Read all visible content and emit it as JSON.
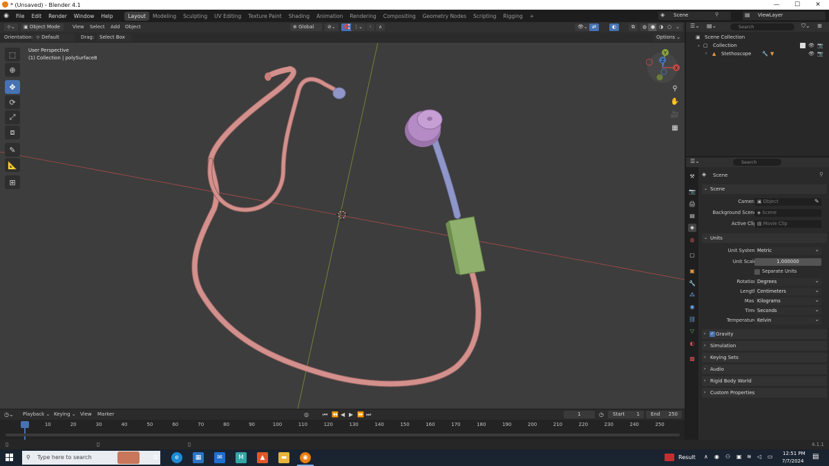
{
  "window": {
    "title": "* (Unsaved) - Blender 4.1"
  },
  "menu": [
    "File",
    "Edit",
    "Render",
    "Window",
    "Help"
  ],
  "workspaces": [
    "Layout",
    "Modeling",
    "Sculpting",
    "UV Editing",
    "Texture Paint",
    "Shading",
    "Animation",
    "Rendering",
    "Compositing",
    "Geometry Nodes",
    "Scripting",
    "Rigging"
  ],
  "scene_selector": "Scene",
  "view_layer": "ViewLayer",
  "viewport_header": {
    "mode": "Object Mode",
    "menus": [
      "View",
      "Select",
      "Add",
      "Object"
    ],
    "transform_orientation": "Global"
  },
  "tool_header": {
    "orientation_label": "Orientation:",
    "orientation_value": "Default",
    "drag_label": "Drag:",
    "drag_value": "Select Box",
    "options_label": "Options"
  },
  "viewport": {
    "perspective_label": "User Perspective",
    "collection_label": "(1) Collection | polySurface8",
    "gizmo": {
      "x": "X",
      "y": "Y",
      "z": "Z"
    }
  },
  "outliner": {
    "search_placeholder": "Search",
    "scene_collection": "Scene Collection",
    "collection": "Collection",
    "object": "Stethoscope"
  },
  "properties": {
    "search_placeholder": "Search",
    "context_title": "Scene",
    "scene_panel": {
      "title": "Scene",
      "camera_label": "Camera",
      "camera_placeholder": "Object",
      "background_scene_label": "Background Scene",
      "background_scene_placeholder": "Scene",
      "active_clip_label": "Active Clip",
      "active_clip_placeholder": "Movie Clip"
    },
    "units_panel": {
      "title": "Units",
      "unit_system_label": "Unit System",
      "unit_system_value": "Metric",
      "unit_scale_label": "Unit Scale",
      "unit_scale_value": "1.000000",
      "separate_units_label": "Separate Units",
      "rotation_label": "Rotation",
      "rotation_value": "Degrees",
      "length_label": "Length",
      "length_value": "Centimeters",
      "mass_label": "Mass",
      "mass_value": "Kilograms",
      "time_label": "Time",
      "time_value": "Seconds",
      "temperature_label": "Temperature",
      "temperature_value": "Kelvin"
    },
    "collapsed_panels": [
      "Gravity",
      "Simulation",
      "Keying Sets",
      "Audio",
      "Rigid Body World",
      "Custom Properties"
    ],
    "gravity_checked": true
  },
  "timeline": {
    "menus": [
      "Playback",
      "Keying",
      "View",
      "Marker"
    ],
    "current_frame": "1",
    "start_label": "Start",
    "start_value": "1",
    "end_label": "End",
    "end_value": "250",
    "ticks": [
      "1",
      "10",
      "20",
      "30",
      "40",
      "50",
      "60",
      "70",
      "80",
      "90",
      "100",
      "110",
      "120",
      "130",
      "140",
      "150",
      "160",
      "170",
      "180",
      "190",
      "200",
      "210",
      "220",
      "230",
      "240",
      "250"
    ]
  },
  "statusbar": {
    "version": "4.1.1"
  },
  "taskbar": {
    "search_placeholder": "Type here to search",
    "result_label": "Result",
    "time": "12:51 PM",
    "date": "7/7/2024"
  },
  "colors": {
    "accent_blue": "#4772b3",
    "stethoscope_tube": "#d4908c",
    "chest_piece": "#b48bc4",
    "stem_tube": "#8f96c9",
    "tag_box": "#8fb06d",
    "axis_x": "#c04848",
    "axis_y": "#8aa23a"
  }
}
